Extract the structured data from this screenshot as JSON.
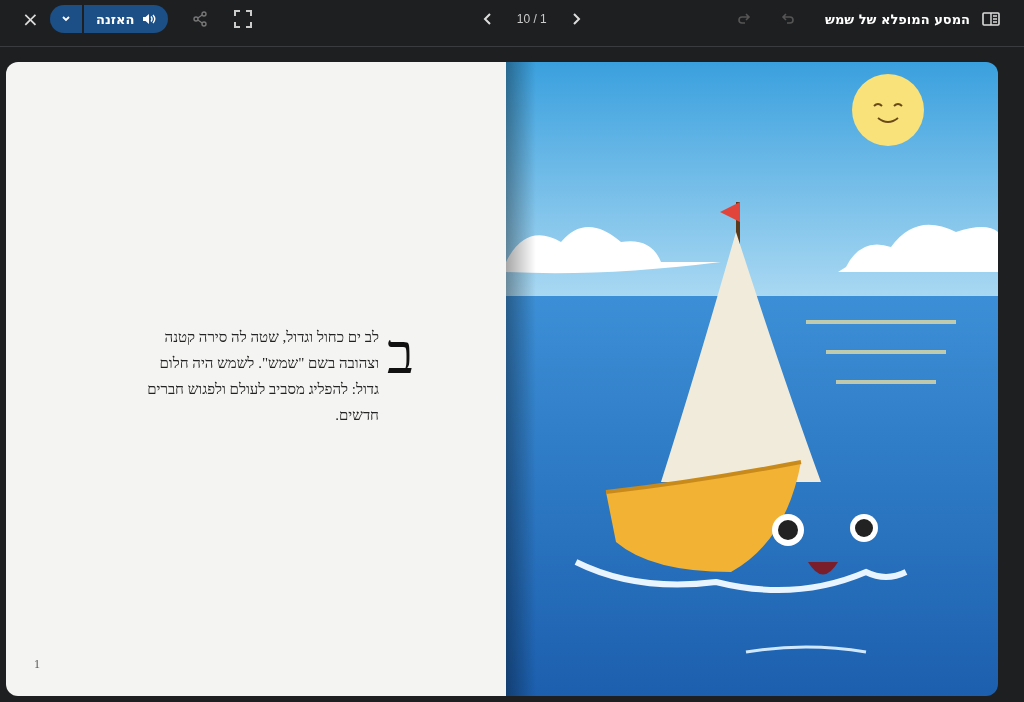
{
  "toolbar": {
    "close": "×",
    "listen": {
      "label": "האזנה"
    },
    "page_counter": "10 / 1",
    "history": [
      {
        "kind": "redo",
        "disabled": true
      },
      {
        "kind": "undo",
        "disabled": true
      }
    ],
    "title": "המסע המופלא של שמש"
  },
  "book": {
    "drop_cap": "ב",
    "text": "לב ים כחול וגדול, שטה לה סירה קטנה וצהובה בשם \"שמש\". לשמש היה חלום גדול: להפליג מסביב לעולם ולפגוש חברים חדשים.",
    "page_number": "1"
  }
}
